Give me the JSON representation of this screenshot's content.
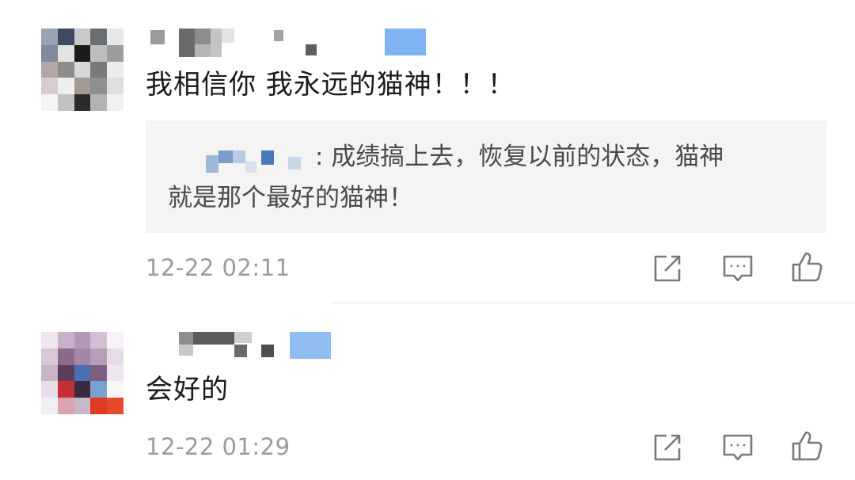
{
  "comments": [
    {
      "text": "我相信你 我永远的猫神！！！",
      "reply_quote": {
        "line1": ": 成绩搞上去，恢复以前的状态，猫神",
        "line2": "就是那个最好的猫神！"
      },
      "timestamp": "12-22 02:11",
      "actions": [
        "share-icon",
        "comment-icon",
        "like-icon"
      ]
    },
    {
      "text": "会好的",
      "timestamp": "12-22 01:29",
      "actions": [
        "share-icon",
        "comment-icon",
        "like-icon"
      ]
    }
  ],
  "colors": {
    "text": "#1a1a1a",
    "muted": "#9b9b9b",
    "quote_bg": "#f4f4f4",
    "icon": "#7a7a7a",
    "badge_blue": "#7fb2f0"
  }
}
